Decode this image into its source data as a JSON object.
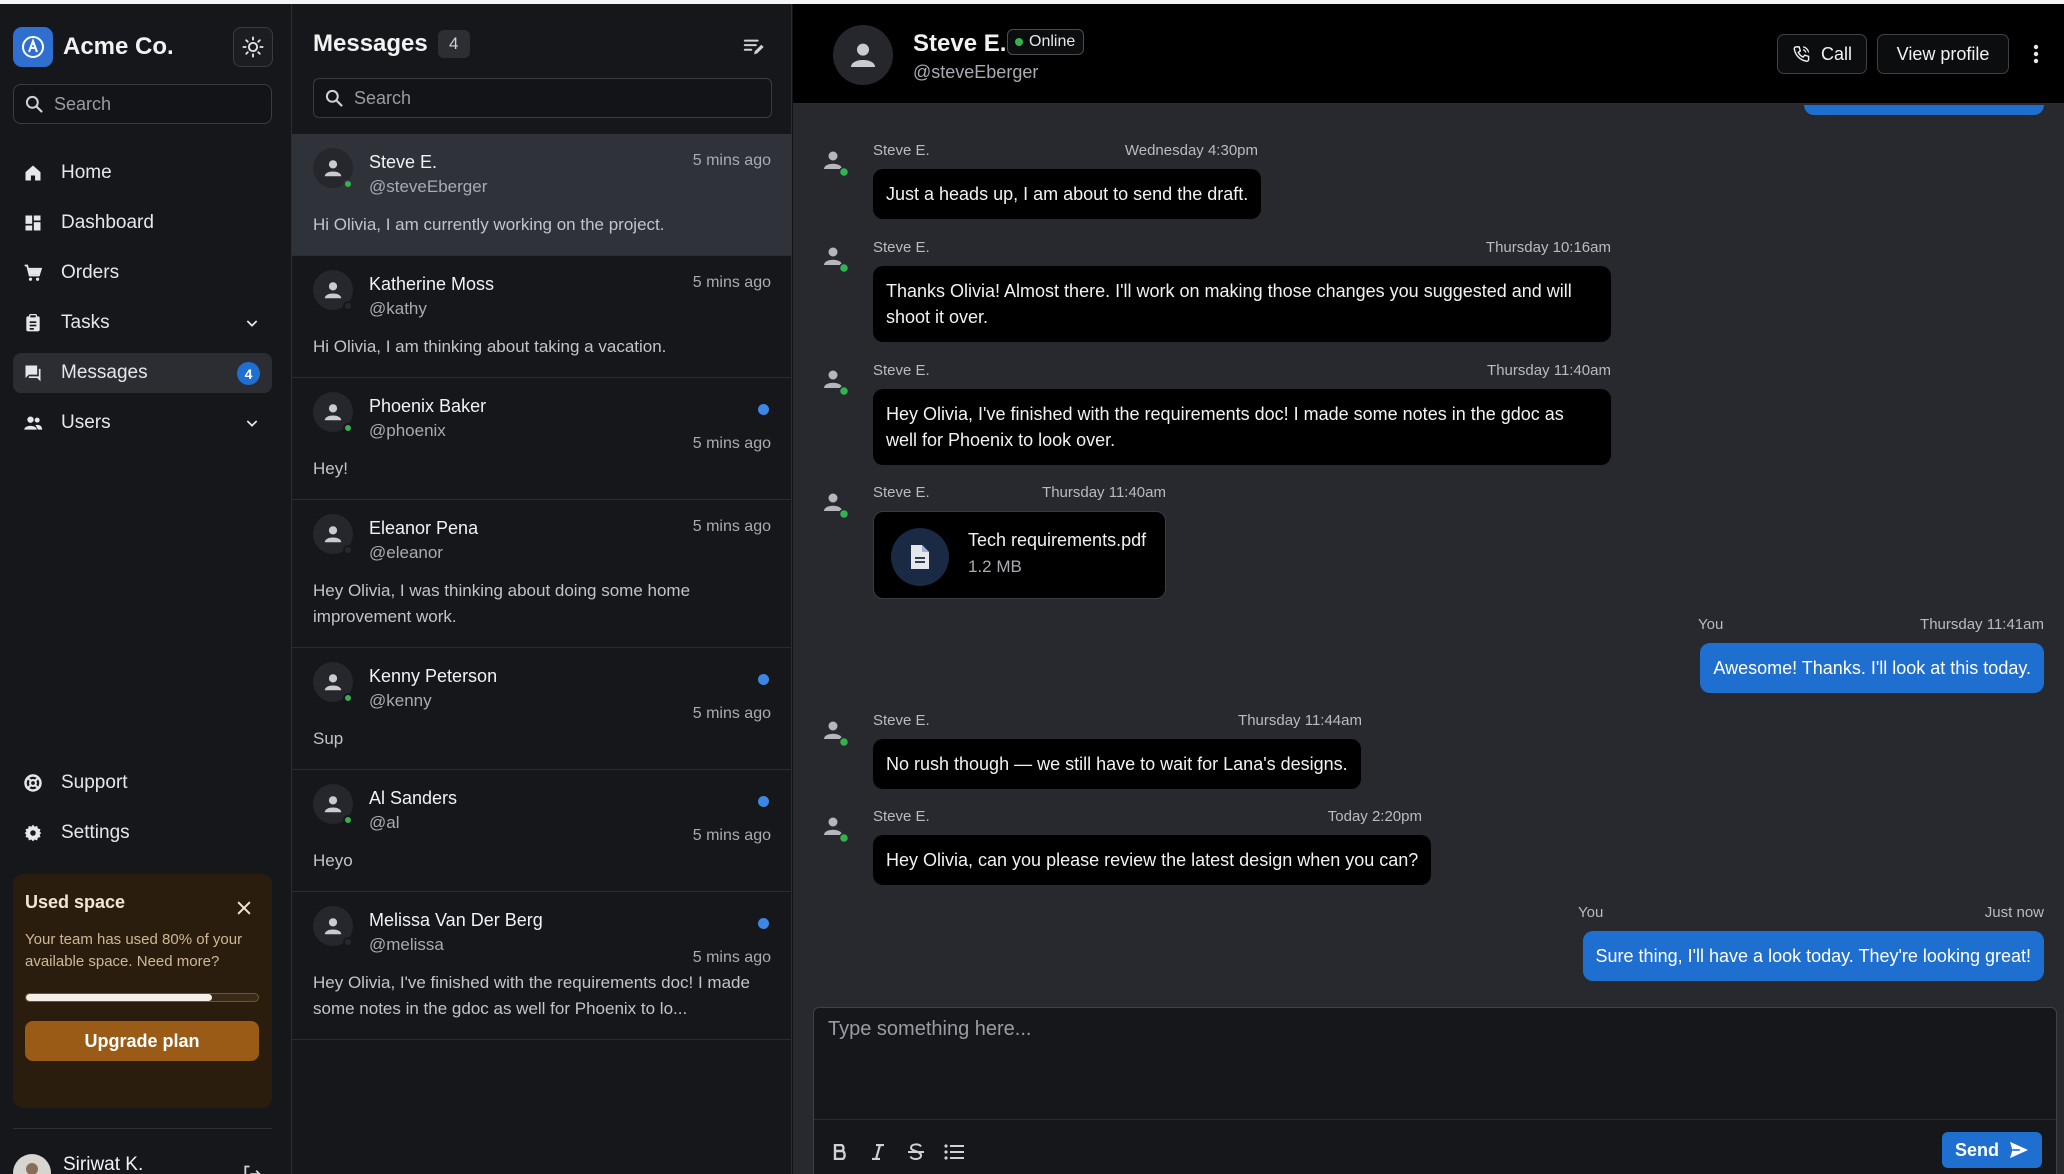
{
  "app": {
    "name": "Acme Co."
  },
  "sidebar": {
    "search_placeholder": "Search",
    "items": [
      {
        "label": "Home",
        "icon": "home-icon"
      },
      {
        "label": "Dashboard",
        "icon": "dashboard-icon"
      },
      {
        "label": "Orders",
        "icon": "cart-icon"
      },
      {
        "label": "Tasks",
        "icon": "clipboard-icon"
      },
      {
        "label": "Messages",
        "icon": "chat-icon",
        "badge": "4"
      },
      {
        "label": "Users",
        "icon": "users-icon"
      }
    ],
    "bottom_items": [
      {
        "label": "Support",
        "icon": "support-icon"
      },
      {
        "label": "Settings",
        "icon": "gear-icon"
      }
    ],
    "space_card": {
      "title": "Used space",
      "text": "Your team has used 80% of your available space. Need more?",
      "used_fraction": 0.8,
      "button": "Upgrade plan"
    },
    "user": {
      "name": "Siriwat K."
    }
  },
  "messages_list": {
    "title": "Messages",
    "count": "4",
    "search_placeholder": "Search",
    "conversations": [
      {
        "name": "Steve E.",
        "handle": "@steveEberger",
        "time": "5 mins ago",
        "preview": "Hi Olivia, I am currently working on the project.",
        "online": true,
        "unread": false
      },
      {
        "name": "Katherine Moss",
        "handle": "@kathy",
        "time": "5 mins ago",
        "preview": "Hi Olivia, I am thinking about taking a vacation.",
        "online": false,
        "unread": false
      },
      {
        "name": "Phoenix Baker",
        "handle": "@phoenix",
        "time": "5 mins ago",
        "preview": "Hey!",
        "online": true,
        "unread": true
      },
      {
        "name": "Eleanor Pena",
        "handle": "@eleanor",
        "time": "5 mins ago",
        "preview": "Hey Olivia, I was thinking about doing some home improvement work.",
        "online": false,
        "unread": false
      },
      {
        "name": "Kenny Peterson",
        "handle": "@kenny",
        "time": "5 mins ago",
        "preview": "Sup",
        "online": true,
        "unread": true
      },
      {
        "name": "Al Sanders",
        "handle": "@al",
        "time": "5 mins ago",
        "preview": "Heyo",
        "online": true,
        "unread": true
      },
      {
        "name": "Melissa Van Der Berg",
        "handle": "@melissa",
        "time": "5 mins ago",
        "preview": "Hey Olivia, I've finished with the requirements doc! I made some notes in the gdoc as well for Phoenix to lo...",
        "online": false,
        "unread": true
      }
    ]
  },
  "chat": {
    "name": "Steve E.",
    "status": "Online",
    "handle": "@steveEberger",
    "call_label": "Call",
    "profile_label": "View profile",
    "messages": [
      {
        "sender": "Steve E.",
        "time": "Wednesday 4:30pm",
        "text": "Just a heads up, I am about to send the draft."
      },
      {
        "sender": "Steve E.",
        "time": "Thursday 10:16am",
        "text": "Thanks Olivia! Almost there. I'll work on making those changes you suggested and will shoot it over."
      },
      {
        "sender": "Steve E.",
        "time": "Thursday 11:40am",
        "text": "Hey Olivia, I've finished with the requirements doc! I made some notes in the gdoc as well for Phoenix to look over."
      },
      {
        "sender": "Steve E.",
        "time": "Thursday 11:40am",
        "file_name": "Tech requirements.pdf",
        "file_size": "1.2 MB"
      },
      {
        "sender": "You",
        "time": "Thursday 11:41am",
        "text": "Awesome! Thanks. I'll look at this today."
      },
      {
        "sender": "Steve E.",
        "time": "Thursday 11:44am",
        "text": "No rush though — we still have to wait for Lana's designs."
      },
      {
        "sender": "Steve E.",
        "time": "Today 2:20pm",
        "text": "Hey Olivia, can you please review the latest design when you can?"
      },
      {
        "sender": "You",
        "time": "Just now",
        "text": "Sure thing, I'll have a look today. They're looking great!"
      }
    ],
    "composer_placeholder": "Type something here...",
    "send_label": "Send"
  },
  "colors": {
    "accent": "#1f6fd1",
    "online": "#33b34d",
    "warning_bg": "#2a1d0e",
    "upgrade": "#9a5b16"
  }
}
